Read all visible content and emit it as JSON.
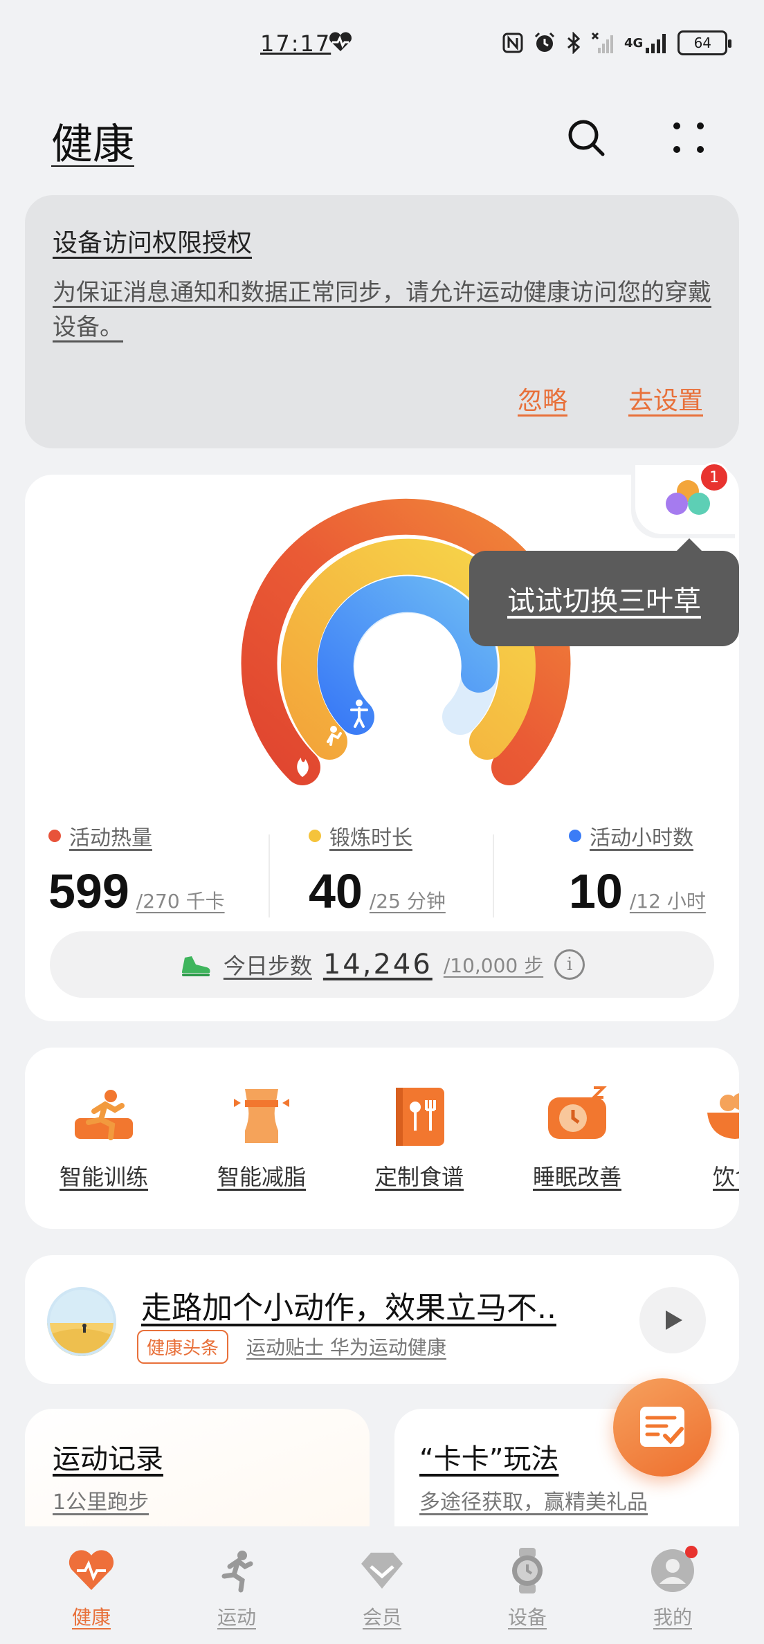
{
  "status_bar": {
    "time": "17:17",
    "network": "4G",
    "battery": "64"
  },
  "header": {
    "title": "健康"
  },
  "permission": {
    "title": "设备访问权限授权",
    "body": "为保证消息通知和数据正常同步，请允许运动健康访问您的穿戴设备。",
    "ignore_label": "忽略",
    "setup_label": "去设置"
  },
  "activity": {
    "tooltip": "试试切换三叶草",
    "badge_count": "1",
    "stats": [
      {
        "label": "活动热量",
        "value": "599",
        "unit": "/270 千卡",
        "color": "#e8533a"
      },
      {
        "label": "锻炼时长",
        "value": "40",
        "unit": "/25 分钟",
        "color": "#f5c33b"
      },
      {
        "label": "活动小时数",
        "value": "10",
        "unit": "/12 小时",
        "color": "#3b7cf6"
      }
    ],
    "steps": {
      "label": "今日步数",
      "value": "14,246",
      "goal": "/10,000 步"
    }
  },
  "services": [
    {
      "label": "智能训练",
      "icon": "running-training-icon"
    },
    {
      "label": "智能减脂",
      "icon": "body-shape-icon"
    },
    {
      "label": "定制食谱",
      "icon": "recipe-book-icon"
    },
    {
      "label": "睡眠改善",
      "icon": "sleep-pillow-icon"
    },
    {
      "label": "饮食",
      "icon": "food-bowl-icon"
    }
  ],
  "article": {
    "title": "走路加个小动作，效果立马不..",
    "tag": "健康头条",
    "source": "运动贴士 华为运动健康"
  },
  "cards": {
    "record_title": "运动记录",
    "record_sub": "1公里跑步",
    "promo_title": "“卡卡”玩法",
    "promo_sub": "多途径获取，赢精美礼品"
  },
  "nav": [
    {
      "label": "健康",
      "icon": "heart-icon",
      "active": true
    },
    {
      "label": "运动",
      "icon": "runner-icon",
      "active": false
    },
    {
      "label": "会员",
      "icon": "diamond-icon",
      "active": false
    },
    {
      "label": "设备",
      "icon": "watch-icon",
      "active": false
    },
    {
      "label": "我的",
      "icon": "profile-icon",
      "active": false
    }
  ],
  "colors": {
    "accent": "#e8703a",
    "ring_red": "#e8533a",
    "ring_yellow": "#f5c33b",
    "ring_blue": "#3b7cf6"
  }
}
